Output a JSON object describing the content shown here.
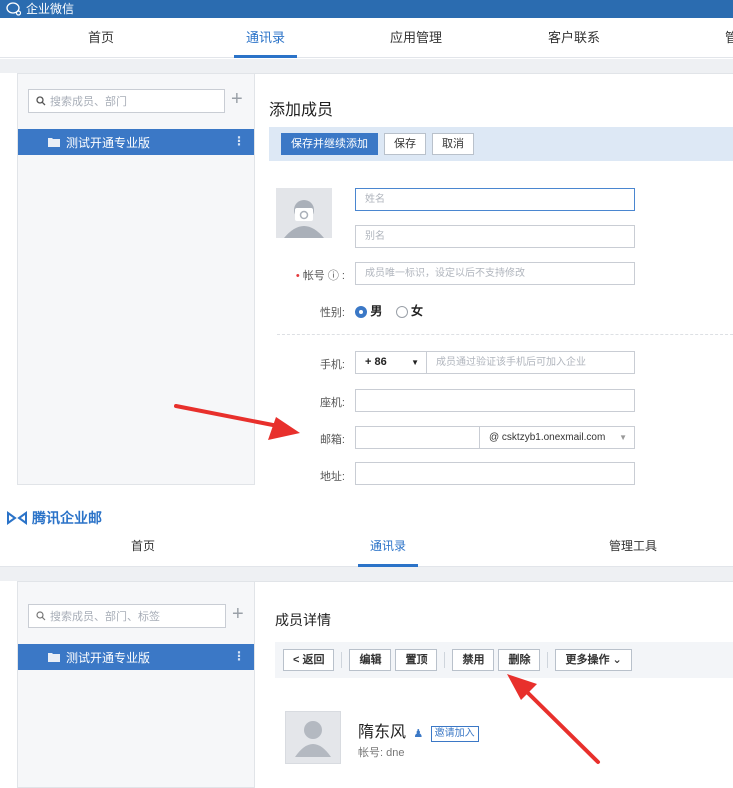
{
  "top": {
    "app_title": "企业微信",
    "nav": [
      "首页",
      "通讯录",
      "应用管理",
      "客户联系",
      "管"
    ],
    "search_placeholder": "搜索成员、部门",
    "department": "测试开通专业版",
    "page_title": "添加成员",
    "buttons": {
      "save_continue": "保存并继续添加",
      "save": "保存",
      "cancel": "取消"
    },
    "fields": {
      "name_placeholder": "姓名",
      "alias_placeholder": "别名",
      "account_label": "帐号",
      "account_info": "ⓘ",
      "account_placeholder": "成员唯一标识，设定以后不支持修改",
      "gender_label": "性别:",
      "male": "男",
      "female": "女",
      "mobile_label": "手机:",
      "country_code": "+ 86",
      "mobile_placeholder": "成员通过验证该手机后可加入企业",
      "landline_label": "座机:",
      "email_label": "邮箱:",
      "email_domain": "@ csktzyb1.onexmail.com",
      "address_label": "地址:"
    }
  },
  "bottom": {
    "app_title": "腾讯企业邮",
    "nav": [
      "首页",
      "通讯录",
      "管理工具"
    ],
    "search_placeholder": "搜索成员、部门、标签",
    "department": "测试开通专业版",
    "page_title": "成员详情",
    "buttons": {
      "back": "< 返回",
      "edit": "编辑",
      "pin": "置顶",
      "disable": "禁用",
      "delete": "删除",
      "more": "更多操作 ⌄"
    },
    "member": {
      "name": "隋东风",
      "invite": "邀请加入",
      "account": "帐号: dne"
    }
  },
  "colors": {
    "accent": "#3b78c6",
    "arrow": "#e8302c"
  }
}
